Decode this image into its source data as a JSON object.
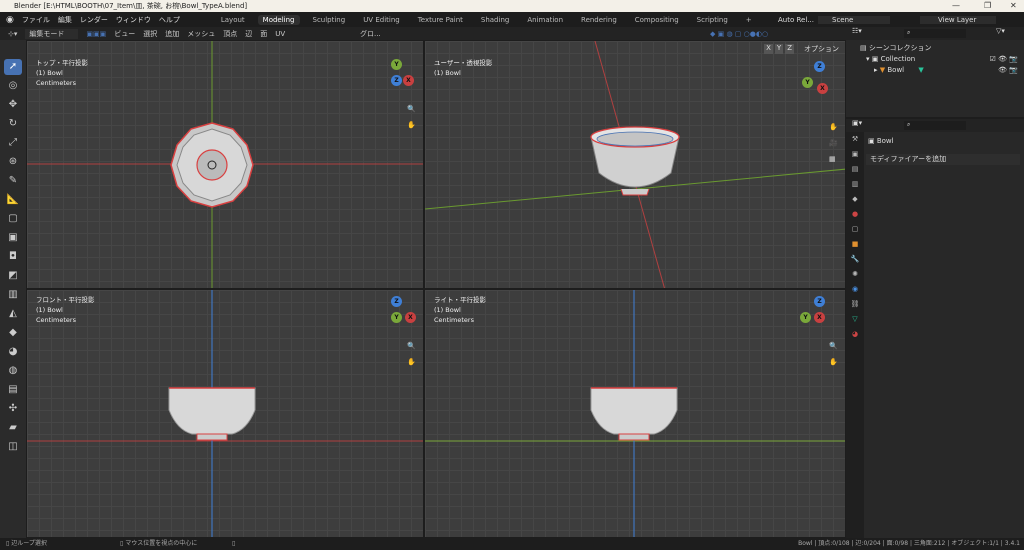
{
  "window": {
    "title": "Blender [E:\\HTML\\BOOTH\\07_Item\\皿, 茶碗, お椀\\Bowl_TypeA.blend]",
    "min": "—",
    "max": "❐",
    "close": "✕"
  },
  "menu": [
    "ファイル",
    "編集",
    "レンダー",
    "ウィンドウ",
    "ヘルプ"
  ],
  "workspaces": [
    {
      "label": "Layout"
    },
    {
      "label": "Modeling",
      "active": true
    },
    {
      "label": "Sculpting"
    },
    {
      "label": "UV Editing"
    },
    {
      "label": "Texture Paint"
    },
    {
      "label": "Shading"
    },
    {
      "label": "Animation"
    },
    {
      "label": "Rendering"
    },
    {
      "label": "Compositing"
    },
    {
      "label": "Scripting"
    },
    {
      "label": "+"
    }
  ],
  "scene": {
    "render": "Auto Rel...",
    "scene": "Scene",
    "view_layer": "View Layer"
  },
  "header": {
    "mode": "編集モード",
    "menus": [
      "ビュー",
      "選択",
      "追加",
      "メッシュ",
      "頂点",
      "辺",
      "面",
      "UV"
    ],
    "transform": "グロ...",
    "axes": [
      "X",
      "Y",
      "Z"
    ],
    "options": "オプション"
  },
  "viewports": [
    {
      "name": "トップ・平行投影",
      "obj": "(1) Bowl",
      "units": "Centimeters"
    },
    {
      "name": "ユーザー・透視投影",
      "obj": "(1) Bowl"
    },
    {
      "name": "フロント・平行投影",
      "obj": "(1) Bowl",
      "units": "Centimeters"
    },
    {
      "name": "ライト・平行投影",
      "obj": "(1) Bowl",
      "units": "Centimeters"
    }
  ],
  "outliner": {
    "root": "シーンコレクション",
    "collection": "Collection",
    "object": "Bowl"
  },
  "properties": {
    "object": "Bowl",
    "add_modifier": "モディファイアーを追加"
  },
  "status": {
    "left": "辺ループ選択",
    "middle": "マウス位置を視点の中心に",
    "right": "Bowl | 頂点:0/108 | 辺:0/204 | 面:0/98 | 三角面:212 | オブジェクト:1/1 | 3.4.1"
  },
  "colors": {
    "accent": "#4772b3",
    "x_axis": "#c84040",
    "y_axis": "#7aa83a",
    "z_axis": "#3f7fd6"
  }
}
